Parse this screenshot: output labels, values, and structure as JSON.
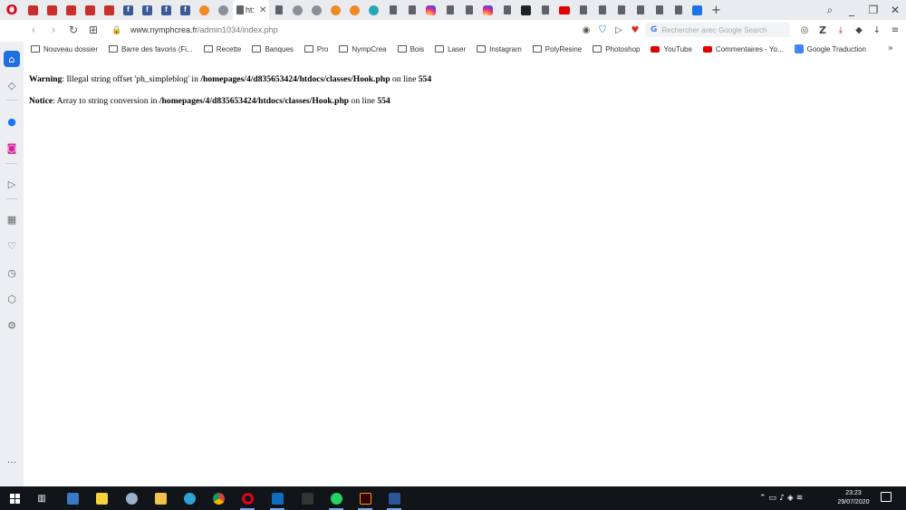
{
  "browser": {
    "active_tab_title": "ht:",
    "active_tab_close": "✕"
  },
  "window_controls": {
    "search": "⌕",
    "minimize": "_",
    "restore": "❐",
    "close": "✕"
  },
  "tabs_new": "+",
  "address": {
    "domain": "www.nymphcrea.fr",
    "path": "/admin1034/index.php",
    "search_placeholder": "Rechercher avec Google Search",
    "search_g": "G"
  },
  "bookmarks": [
    {
      "label": "Nouveau dossier",
      "icon": "folder"
    },
    {
      "label": "Barre des favoris (Fi...",
      "icon": "folder"
    },
    {
      "label": "Recette",
      "icon": "folder"
    },
    {
      "label": "Banques",
      "icon": "folder"
    },
    {
      "label": "Pro",
      "icon": "folder"
    },
    {
      "label": "NympCrea",
      "icon": "folder"
    },
    {
      "label": "Bois",
      "icon": "folder"
    },
    {
      "label": "Laser",
      "icon": "folder"
    },
    {
      "label": "Instagram",
      "icon": "folder"
    },
    {
      "label": "PolyResine",
      "icon": "folder"
    },
    {
      "label": "Photoshop",
      "icon": "folder"
    },
    {
      "label": "YouTube",
      "icon": "youtube"
    },
    {
      "label": "Commentaires - Yo...",
      "icon": "youtube"
    },
    {
      "label": "Google Traduction",
      "icon": "google-translate"
    }
  ],
  "bookmarks_more": "»",
  "messages": [
    {
      "level": "Warning",
      "pre": ": Illegal string offset 'ph_simpleblog' in ",
      "file": "/homepages/4/d835653424/htdocs/classes/Hook.php",
      "mid": " on line ",
      "line": "554"
    },
    {
      "level": "Notice",
      "pre": ": Array to string conversion in ",
      "file": "/homepages/4/d835653424/htdocs/classes/Hook.php",
      "mid": " on line ",
      "line": "554"
    }
  ],
  "ext": {
    "z": "Z"
  },
  "taskbar": {
    "time": "23:23",
    "date": "29/07/2020"
  },
  "sidebar_more": "···",
  "colors": {
    "opera_red": "#e0001b",
    "sidebar_active": "#1f6fe0",
    "taskbar": "#111418"
  }
}
